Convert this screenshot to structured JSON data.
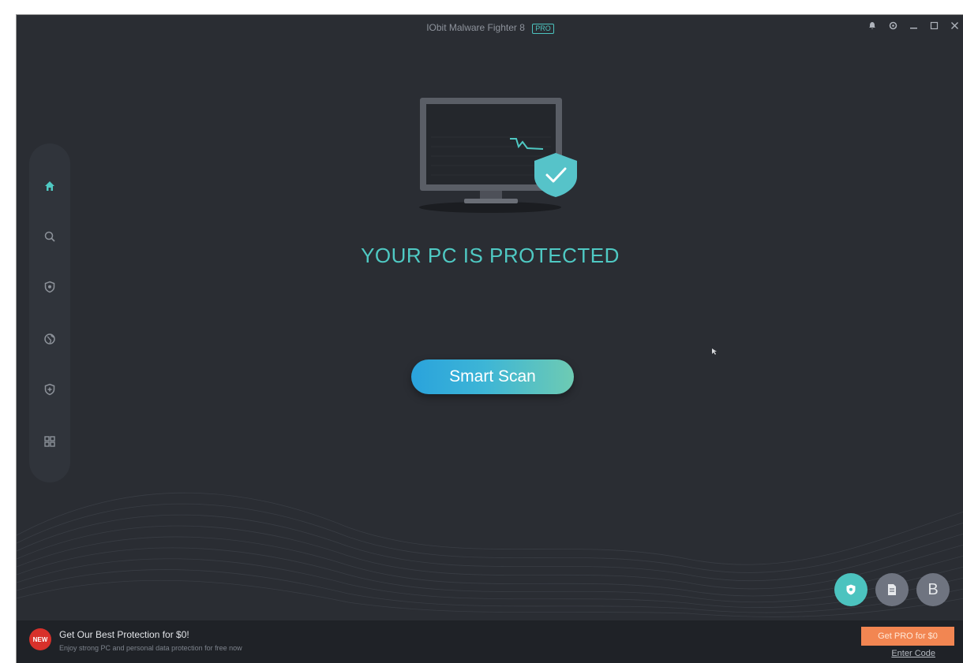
{
  "window": {
    "title": "IObit Malware Fighter 8",
    "title_badge": "PRO"
  },
  "titlebar_icons": [
    "bell-icon",
    "menu-icon",
    "minimize-icon",
    "maximize-icon",
    "close-icon"
  ],
  "sidebar": {
    "items": [
      {
        "name": "home",
        "icon": "home-icon",
        "active": true
      },
      {
        "name": "scan",
        "icon": "search-icon",
        "active": false
      },
      {
        "name": "protection",
        "icon": "shield-icon",
        "active": false
      },
      {
        "name": "browser-protection",
        "icon": "globe-icon",
        "active": false
      },
      {
        "name": "action-center",
        "icon": "shield-plus-icon",
        "active": false
      },
      {
        "name": "more-tools",
        "icon": "grid-icon",
        "active": false
      }
    ]
  },
  "main": {
    "status_text": "YOUR PC IS PROTECTED",
    "scan_button_label": "Smart Scan"
  },
  "corner_buttons": [
    {
      "icon": "shield-icon",
      "color": "#4cc3bf"
    },
    {
      "icon": "document-icon",
      "color": "#6f7480"
    },
    {
      "label": "B",
      "color": "#6f7480"
    }
  ],
  "footer": {
    "promo_badge": "NEW",
    "promo_title": "Get Our Best Protection for $0!",
    "promo_subtitle": "Enjoy strong PC and personal data protection for free now",
    "pro_button_label": "Get PRO for $0",
    "enter_code_label": "Enter Code"
  },
  "colors": {
    "accent": "#4fc9c3",
    "background": "#2a2d33",
    "promo_button": "#f28652"
  }
}
